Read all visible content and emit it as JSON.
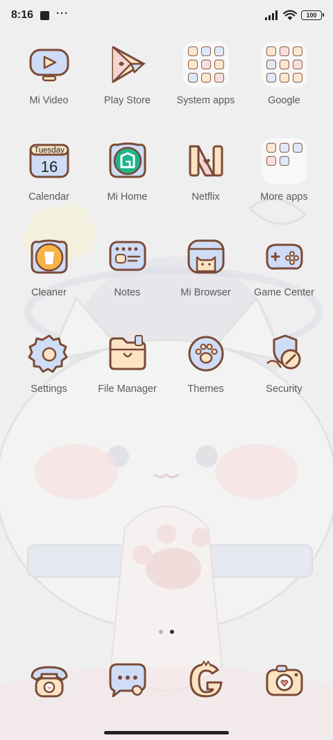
{
  "status_bar": {
    "time": "8:16",
    "battery": "100",
    "notification_icons": [
      "square-notification-icon",
      "more-dots-icon"
    ],
    "system_icons": [
      "signal-icon",
      "wifi-icon",
      "battery-icon"
    ]
  },
  "apps": [
    {
      "label": "Mi Video",
      "icon": "video-play-icon"
    },
    {
      "label": "Play Store",
      "icon": "play-store-icon"
    },
    {
      "label": "System apps",
      "icon": "folder-icon"
    },
    {
      "label": "Google",
      "icon": "folder-icon"
    },
    {
      "label": "Calendar",
      "icon": "calendar-icon",
      "day_name": "Tuesday",
      "day_number": "16"
    },
    {
      "label": "Mi Home",
      "icon": "mi-home-icon"
    },
    {
      "label": "Netflix",
      "icon": "netflix-icon"
    },
    {
      "label": "More apps",
      "icon": "folder-icon"
    },
    {
      "label": "Cleaner",
      "icon": "trash-cleaner-icon"
    },
    {
      "label": "Notes",
      "icon": "notes-icon"
    },
    {
      "label": "Mi Browser",
      "icon": "cat-browser-icon"
    },
    {
      "label": "Game Center",
      "icon": "gamepad-icon"
    },
    {
      "label": "Settings",
      "icon": "gear-icon"
    },
    {
      "label": "File Manager",
      "icon": "file-folder-icon"
    },
    {
      "label": "Themes",
      "icon": "paw-palette-icon"
    },
    {
      "label": "Security",
      "icon": "shield-security-icon"
    }
  ],
  "dock": [
    {
      "icon": "phone-icon"
    },
    {
      "icon": "messages-icon"
    },
    {
      "icon": "google-g-icon"
    },
    {
      "icon": "camera-icon"
    }
  ],
  "pager": {
    "pages": 2,
    "active": 2
  },
  "colors": {
    "outline": "#7a4a36",
    "cream": "#fbe3c3",
    "blue": "#cfdcf6",
    "pink": "#f6d3d3",
    "green": "#1fb58a",
    "orange": "#f6b34a"
  }
}
